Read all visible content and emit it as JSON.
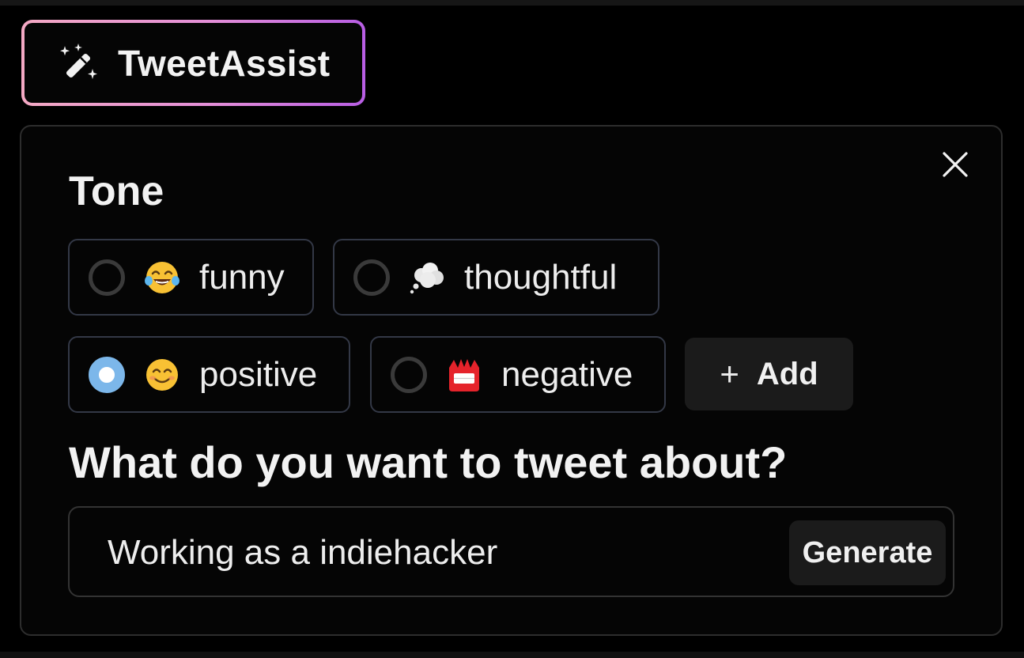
{
  "app": {
    "button_label": "TweetAssist"
  },
  "panel": {
    "tone_title": "Tone",
    "tones": [
      {
        "label": "funny",
        "emoji": "face-with-tears-of-joy",
        "selected": false
      },
      {
        "label": "thoughtful",
        "emoji": "thought-balloon",
        "selected": false
      },
      {
        "label": "positive",
        "emoji": "smiling-face",
        "selected": true
      },
      {
        "label": "negative",
        "emoji": "angry-symbol-face",
        "selected": false
      }
    ],
    "add_label": "Add",
    "question": "What do you want to tweet about?",
    "input_value": "Working as a indiehacker",
    "generate_label": "Generate"
  },
  "colors": {
    "gradient_start": "#f4a9c4",
    "gradient_end": "#b85ee4",
    "radio_selected": "#7cb7ea",
    "chip_border": "#333846",
    "button_bg": "#1b1b1b"
  }
}
